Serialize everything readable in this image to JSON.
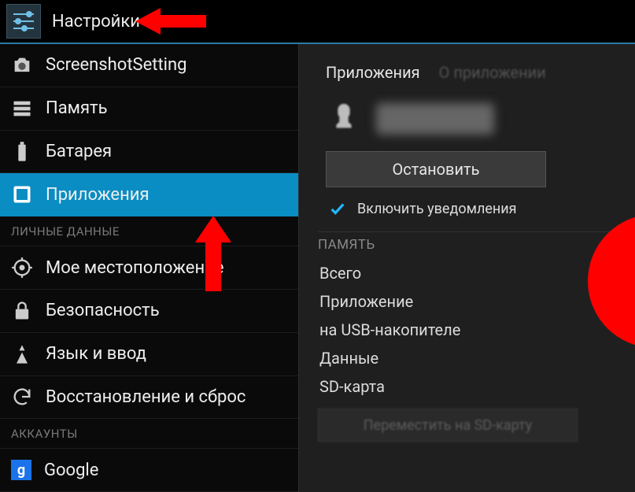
{
  "header": {
    "title": "Настройки"
  },
  "sidebar": {
    "items": [
      {
        "label": "ScreenshotSetting",
        "icon": "camera-icon"
      },
      {
        "label": "Память",
        "icon": "storage-icon"
      },
      {
        "label": "Батарея",
        "icon": "battery-icon"
      },
      {
        "label": "Приложения",
        "icon": "apps-icon",
        "selected": true
      },
      {
        "label": "Мое местоположение",
        "icon": "location-icon"
      },
      {
        "label": "Безопасность",
        "icon": "lock-icon"
      },
      {
        "label": "Язык и ввод",
        "icon": "keyboard-icon"
      },
      {
        "label": "Восстановление и сброс",
        "icon": "backup-icon"
      },
      {
        "label": "Google",
        "icon": "google-icon"
      }
    ],
    "section_personal": "ЛИЧНЫЕ ДАННЫЕ",
    "section_accounts": "АККАУНТЫ"
  },
  "detail": {
    "tab_active": "Приложения",
    "tab_inactive": "О приложении",
    "stop_button": "Остановить",
    "notify_label": "Включить уведомления",
    "mem_header": "ПАМЯТЬ",
    "mem_rows": {
      "r0": "Всего",
      "r1": "Приложение",
      "r2": "на USB-накопителе",
      "r3": "Данные",
      "r4": "SD-карта"
    },
    "move_button": "Переместить на SD-карту"
  },
  "annotation_colors": {
    "arrow": "#ff0000"
  }
}
